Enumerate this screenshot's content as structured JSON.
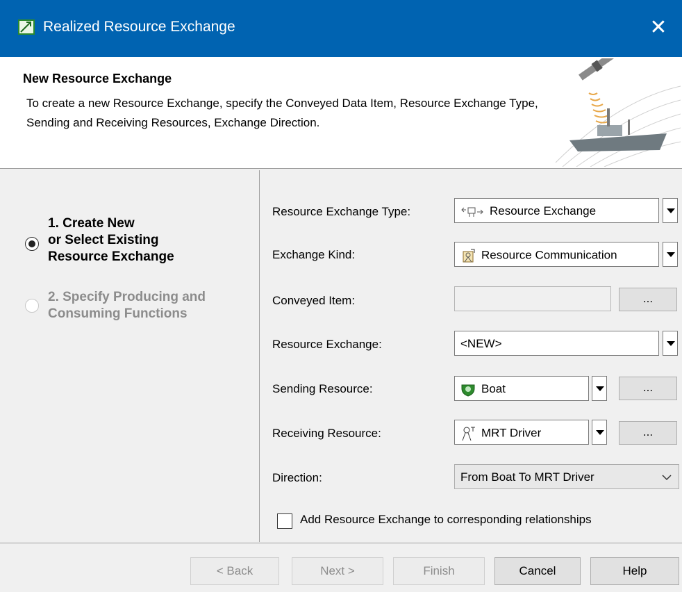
{
  "window": {
    "title": "Realized Resource Exchange",
    "close_glyph": "✕"
  },
  "header": {
    "title": "New Resource Exchange",
    "description": "To create a new Resource Exchange, specify the Conveyed Data Item, Resource Exchange Type, Sending and Receiving Resources, Exchange Direction."
  },
  "steps": [
    {
      "line1": "1. Create New",
      "line2": "or Select Existing",
      "line3": "Resource Exchange",
      "selected": true
    },
    {
      "line1": "2. Specify Producing and",
      "line2": "Consuming Functions",
      "selected": false
    }
  ],
  "form": {
    "exchange_type": {
      "label": "Resource Exchange Type:",
      "value": "Resource Exchange",
      "icon": "resource-exchange-icon"
    },
    "exchange_kind": {
      "label": "Exchange Kind:",
      "value": "Resource Communication",
      "icon": "resource-communication-icon"
    },
    "conveyed_item": {
      "label": "Conveyed Item:",
      "value": "",
      "button": "..."
    },
    "resource_exchange": {
      "label": "Resource Exchange:",
      "value": "<NEW>"
    },
    "sending": {
      "label": "Sending Resource:",
      "value": "Boat",
      "button": "...",
      "icon": "boat-resource-icon"
    },
    "receiving": {
      "label": "Receiving Resource:",
      "value": "MRT Driver",
      "button": "...",
      "icon": "role-icon"
    },
    "direction": {
      "label": "Direction:",
      "value": "From Boat To MRT Driver"
    },
    "add_checkbox": {
      "label": "Add Resource Exchange to corresponding relationships",
      "checked": false
    }
  },
  "buttons": {
    "back": "< Back",
    "next": "Next >",
    "finish": "Finish",
    "cancel": "Cancel",
    "help": "Help"
  },
  "colors": {
    "titlebar": "#0063b1",
    "disabled_text": "#8c8c8c",
    "boat_icon": "#2e8b2e"
  }
}
